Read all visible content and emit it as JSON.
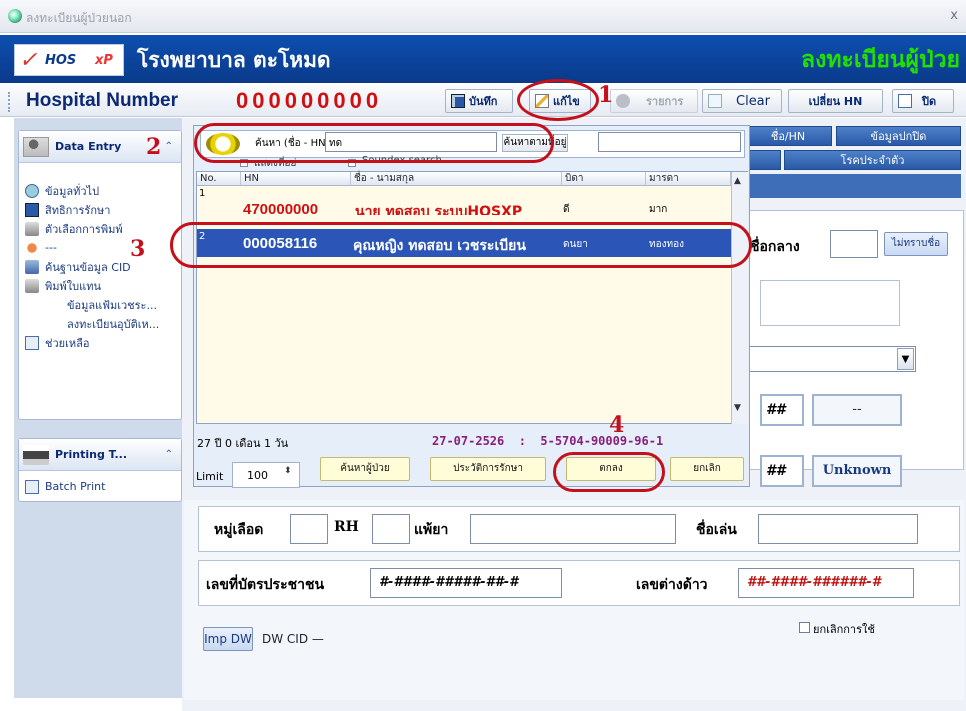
{
  "window": {
    "title": "ลงทะเบียนผู้ป่วยนอก",
    "close": "x"
  },
  "header": {
    "logo_sw": "✓",
    "logo_hos": "HOS",
    "logo_xp": "xP",
    "hospital": "โรงพยาบาล ตะโหมด",
    "module_title": "ลงทะเบียนผู้ป่วย"
  },
  "toolbar": {
    "hn_label": "Hospital Number",
    "hn_value": "000000000",
    "save": "บันทึก",
    "edit": "แก้ไข",
    "items": "รายการ",
    "clear": "Clear",
    "change_hn": "เปลี่ยน HN",
    "close": "ปิด"
  },
  "sidebar": {
    "data_entry": {
      "title": "Data Entry",
      "items": [
        {
          "label": "ข้อมูลทั่วไป"
        },
        {
          "label": "สิทธิการรักษา"
        },
        {
          "label": "ตัวเลือกการพิมพ์"
        },
        {
          "label": "---"
        },
        {
          "label": "ค้นฐานข้อมูล CID"
        },
        {
          "label": "พิมพ์ใบแทน"
        },
        {
          "label": "ข้อมูลแฟ้มเวชระ..."
        },
        {
          "label": "ลงทะเบียนอุบัติเห..."
        },
        {
          "label": "ช่วยเหลือ"
        }
      ]
    },
    "printing": {
      "title": "Printing T...",
      "items": [
        {
          "label": "Batch Print"
        }
      ]
    }
  },
  "search": {
    "label": "ค้นหา (ชื่อ - HN)",
    "value": "ทด",
    "addr_label": "ค้นหาตามที่อยู่",
    "addr_value": "",
    "show_addr": "แสดงที่อยู่",
    "soundex": "Soundex search"
  },
  "grid": {
    "columns": [
      "No.",
      "HN",
      "ชื่อ - นามสกุล",
      "บิดา",
      "มารดา"
    ],
    "rows": [
      {
        "no": "1",
        "hn": "470000000",
        "name": "นาย ทดสอบ ระบบHOSXP",
        "father": "ดี",
        "mother": "มาก"
      },
      {
        "no": "2",
        "hn": "000058116",
        "name": "คุณหญิง ทดสอบ เวชระเบียน",
        "father": "ดนยา",
        "mother": "ทองทอง"
      }
    ]
  },
  "footer": {
    "age": "27 ปี 0 เดือน 1 วัน",
    "dob_cid": "27-07-2526  :  5-5704-90009-96-1",
    "limit_label": "Limit",
    "limit_value": "100",
    "find_patient": "ค้นหาผู้ป่วย",
    "history": "ประวัติการรักษา",
    "ok": "ตกลง",
    "cancel": "ยกเลิก"
  },
  "annotations": {
    "n1": "1",
    "n2": "2",
    "n3": "3",
    "n4": "4"
  },
  "right": {
    "tab1": "ชื่อ/HN",
    "tab2": "ข้อมูลปกปิด",
    "tab3": "โรคประจำตัว",
    "middle_name_label": "ชื่อกลาง",
    "unknown_name_btn": "ไม่ทราบชื่อ",
    "hash1": "##",
    "dash": "--",
    "hash2": "##",
    "unknown": "Unknown"
  },
  "form": {
    "blood_label": "หมู่เลือด",
    "rh_label": "RH",
    "allergy_label": "แพ้ยา",
    "nickname_label": "ชื่อเล่น",
    "cid_label": "เลขที่บัตรประชาชน",
    "cid_value": "#-####-#####-##-#",
    "alien_label": "เลขต่างด้าว",
    "alien_value": "##-####-######-#",
    "cancel_use": "ยกเลิกการใช้",
    "imp_dw": "Imp DW",
    "dw_cid": "DW CID —"
  }
}
